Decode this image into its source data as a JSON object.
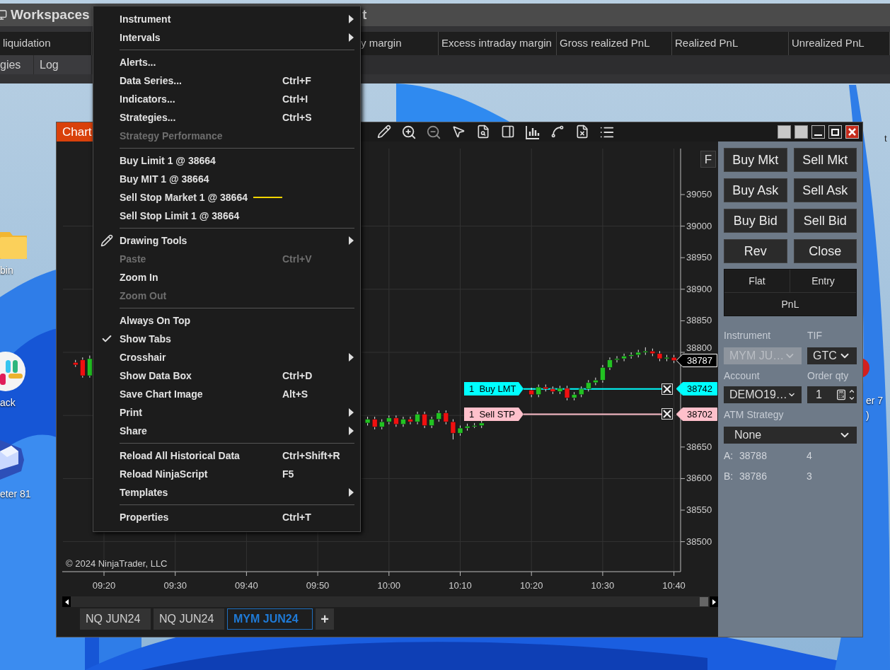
{
  "desktop": {
    "icons": [
      {
        "kind": "folder",
        "label": "bin"
      },
      {
        "kind": "hash",
        "label": "ack"
      },
      {
        "kind": "cube",
        "label": "eter 81"
      }
    ],
    "right_icon": {
      "label": "er 7",
      "label_tail": ")"
    },
    "edge_text": "t"
  },
  "control_center": {
    "title": "Workspaces",
    "title_tail": "t",
    "columns": [
      "liquidation",
      "y margin",
      "Excess intraday margin",
      "Gross realized PnL",
      "Realized PnL",
      "Unrealized PnL"
    ],
    "tabs": [
      "gies",
      "Log"
    ]
  },
  "chart_window": {
    "title": "Chart",
    "chart_data": {
      "type": "candlestick",
      "grid": true,
      "ylim": [
        38452.5,
        39122.9
      ],
      "categories": [
        null,
        null,
        null,
        null,
        null,
        "09:20",
        null,
        null,
        null,
        null,
        null,
        null,
        null,
        null,
        null,
        "09:30",
        null,
        null,
        null,
        null,
        null,
        null,
        null,
        null,
        null,
        "09:40",
        null,
        null,
        null,
        null,
        null,
        null,
        null,
        null,
        null,
        "09:50",
        null,
        null,
        null,
        null,
        null,
        null,
        null,
        null,
        null,
        "10:00",
        null,
        null,
        null,
        null,
        null,
        null,
        null,
        null,
        null,
        "10:10",
        null,
        null,
        null,
        null,
        null,
        null,
        null,
        null,
        null,
        "10:20",
        null,
        null,
        null,
        null,
        null,
        null,
        null,
        null,
        null,
        "10:30",
        null,
        null,
        null,
        null,
        null,
        null,
        null,
        null,
        null,
        "10:40"
      ],
      "ohlc": [
        null,
        [
          38784,
          38788,
          38777,
          38780
        ],
        [
          38788,
          38792,
          38760,
          38763
        ],
        [
          38763,
          38795,
          38760,
          38790
        ],
        null,
        null,
        null,
        null,
        null,
        null,
        null,
        null,
        null,
        null,
        null,
        null,
        null,
        null,
        null,
        null,
        null,
        null,
        null,
        null,
        null,
        null,
        null,
        null,
        null,
        null,
        null,
        null,
        null,
        null,
        null,
        null,
        null,
        null,
        null,
        null,
        null,
        null,
        [
          38688,
          38698,
          38684,
          38694
        ],
        [
          38694,
          38698,
          38678,
          38682
        ],
        [
          38682,
          38694,
          38678,
          38690
        ],
        [
          38690,
          38700,
          38686,
          38696
        ],
        [
          38696,
          38700,
          38682,
          38686
        ],
        [
          38686,
          38698,
          38682,
          38694
        ],
        [
          38694,
          38698,
          38686,
          38690
        ],
        [
          38690,
          38706,
          38686,
          38702
        ],
        [
          38702,
          38706,
          38680,
          38684
        ],
        [
          38684,
          38698,
          38680,
          38694
        ],
        [
          38694,
          38708,
          38690,
          38704
        ],
        [
          38704,
          38708,
          38686,
          38690
        ],
        [
          38690,
          38694,
          38662,
          38672
        ],
        [
          38672,
          38684,
          38668,
          38680
        ],
        [
          38680,
          38687,
          38676,
          38683
        ],
        [
          38683,
          38688,
          38680,
          38684
        ],
        [
          38684,
          38692,
          38680,
          38688
        ],
        null,
        null,
        null,
        null,
        null,
        null,
        [
          38740,
          38744,
          38729,
          38733
        ],
        [
          38733,
          38749,
          38729,
          38745
        ],
        [
          38745,
          38749,
          38738,
          38742
        ],
        [
          38742,
          38746,
          38734,
          38738
        ],
        [
          38738,
          38747,
          38734,
          38743
        ],
        [
          38743,
          38747,
          38724,
          38728
        ],
        [
          38728,
          38737,
          38724,
          38733
        ],
        [
          38733,
          38746,
          38729,
          38742
        ],
        [
          38742,
          38756,
          38738,
          38752
        ],
        [
          38752,
          38760,
          38748,
          38756
        ],
        [
          38756,
          38780,
          38752,
          38776
        ],
        [
          38776,
          38792,
          38772,
          38788
        ],
        [
          38788,
          38794,
          38784,
          38790
        ],
        [
          38790,
          38798,
          38786,
          38794
        ],
        [
          38794,
          38800,
          38790,
          38796
        ],
        [
          38796,
          38804,
          38792,
          38800
        ],
        [
          38800,
          38808,
          38796,
          38802
        ],
        [
          38802,
          38806,
          38794,
          38798
        ],
        [
          38798,
          38802,
          38786,
          38790
        ],
        [
          38790,
          38796,
          38786,
          38792
        ],
        [
          38792,
          38796,
          38783,
          38787
        ]
      ],
      "yticks": [
        {
          "value": 39050,
          "label": "39050"
        },
        {
          "value": 39000,
          "label": "39000"
        },
        {
          "value": 38950,
          "label": "38950"
        },
        {
          "value": 38900,
          "label": "38900"
        },
        {
          "value": 38850,
          "label": "38850"
        },
        {
          "value": 38800,
          "label": "38800"
        },
        {
          "value": 38650,
          "label": "38650"
        },
        {
          "value": 38600,
          "label": "38600"
        },
        {
          "value": 38550,
          "label": "38550"
        },
        {
          "value": 38500,
          "label": "38500"
        }
      ]
    },
    "f_button": "F",
    "copyright": "© 2024 NinjaTrader, LLC",
    "last_price": "38787",
    "orders": [
      {
        "label": "1  Buy LMT",
        "price": "38742",
        "color": "#00ffff"
      },
      {
        "label": "1  Sell STP",
        "price": "38702",
        "color": "#ffc0cb"
      }
    ],
    "tabs": [
      {
        "label": "NQ JUN24",
        "selected": false
      },
      {
        "label": "NQ JUN24",
        "selected": false
      },
      {
        "label": "MYM JUN24",
        "selected": true
      }
    ],
    "add_tab": "+"
  },
  "chart_trader": {
    "buttons": [
      "Buy Mkt",
      "Sell Mkt",
      "Buy Ask",
      "Sell Ask",
      "Buy Bid",
      "Sell Bid",
      "Rev",
      "Close"
    ],
    "position": {
      "flat": "Flat",
      "entry": "Entry",
      "pnl": "PnL"
    },
    "instrument": {
      "label": "Instrument",
      "value": "MYM JU…",
      "disabled": true
    },
    "tif": {
      "label": "TIF",
      "value": "GTC",
      "disabled": false
    },
    "account": {
      "label": "Account",
      "value": "DEMO19…",
      "disabled": false
    },
    "order_qty": {
      "label": "Order qty",
      "value": "1"
    },
    "atm_strategy": {
      "label": "ATM Strategy",
      "value": "None"
    },
    "quotes": [
      {
        "side": "A:",
        "price": "38788",
        "size": "4"
      },
      {
        "side": "B:",
        "price": "38786",
        "size": "3"
      }
    ]
  },
  "context_menu": [
    {
      "kind": "item",
      "label": "Instrument",
      "submenu": true,
      "disabled": false,
      "checked": false
    },
    {
      "kind": "item",
      "label": "Intervals",
      "submenu": true,
      "disabled": false,
      "checked": false
    },
    {
      "kind": "separator"
    },
    {
      "kind": "item",
      "label": "Alerts...",
      "submenu": false,
      "disabled": false,
      "checked": false
    },
    {
      "kind": "item",
      "label": "Data Series...",
      "shortcut": "Ctrl+F",
      "submenu": false,
      "disabled": false,
      "checked": false
    },
    {
      "kind": "item",
      "label": "Indicators...",
      "shortcut": "Ctrl+I",
      "submenu": false,
      "disabled": false,
      "checked": false
    },
    {
      "kind": "item",
      "label": "Strategies...",
      "shortcut": "Ctrl+S",
      "submenu": false,
      "disabled": false,
      "checked": false
    },
    {
      "kind": "item",
      "label": "Strategy Performance",
      "submenu": false,
      "disabled": true,
      "checked": false
    },
    {
      "kind": "separator"
    },
    {
      "kind": "item",
      "label": "Buy Limit 1 @ 38664",
      "submenu": false,
      "disabled": false,
      "checked": false
    },
    {
      "kind": "item",
      "label": "Buy MIT 1 @ 38664",
      "submenu": false,
      "disabled": false,
      "checked": false
    },
    {
      "kind": "marked_item",
      "label": "Sell Stop Market 1 @ 38664",
      "submenu": false,
      "disabled": false,
      "checked": false
    },
    {
      "kind": "item",
      "label": "Sell Stop Limit 1 @ 38664",
      "submenu": false,
      "disabled": false,
      "checked": false
    },
    {
      "kind": "separator"
    },
    {
      "kind": "tool_item",
      "label": "Drawing Tools",
      "submenu": true,
      "disabled": false,
      "checked": false
    },
    {
      "kind": "item",
      "label": "Paste",
      "shortcut": "Ctrl+V",
      "submenu": false,
      "disabled": true,
      "checked": false
    },
    {
      "kind": "item",
      "label": "Zoom In",
      "submenu": false,
      "disabled": false,
      "checked": false
    },
    {
      "kind": "item",
      "label": "Zoom Out",
      "submenu": false,
      "disabled": true,
      "checked": false
    },
    {
      "kind": "separator"
    },
    {
      "kind": "item",
      "label": "Always On Top",
      "submenu": false,
      "disabled": false,
      "checked": false
    },
    {
      "kind": "item",
      "label": "Show Tabs",
      "submenu": false,
      "disabled": false,
      "checked": true
    },
    {
      "kind": "item",
      "label": "Crosshair",
      "submenu": true,
      "disabled": false,
      "checked": false
    },
    {
      "kind": "item",
      "label": "Show Data Box",
      "shortcut": "Ctrl+D",
      "submenu": false,
      "disabled": false,
      "checked": false
    },
    {
      "kind": "item",
      "label": "Save Chart Image",
      "shortcut": "Alt+S",
      "submenu": false,
      "disabled": false,
      "checked": false
    },
    {
      "kind": "item",
      "label": "Print",
      "submenu": true,
      "disabled": false,
      "checked": false
    },
    {
      "kind": "item",
      "label": "Share",
      "submenu": true,
      "disabled": false,
      "checked": false
    },
    {
      "kind": "separator"
    },
    {
      "kind": "item",
      "label": "Reload All Historical Data",
      "shortcut": "Ctrl+Shift+R",
      "submenu": false,
      "disabled": false,
      "checked": false
    },
    {
      "kind": "item",
      "label": "Reload NinjaScript",
      "shortcut": "F5",
      "submenu": false,
      "disabled": false,
      "checked": false
    },
    {
      "kind": "item",
      "label": "Templates",
      "submenu": true,
      "disabled": false,
      "checked": false
    },
    {
      "kind": "separator"
    },
    {
      "kind": "item",
      "label": "Properties",
      "shortcut": "Ctrl+T",
      "submenu": false,
      "disabled": false,
      "checked": false
    }
  ]
}
